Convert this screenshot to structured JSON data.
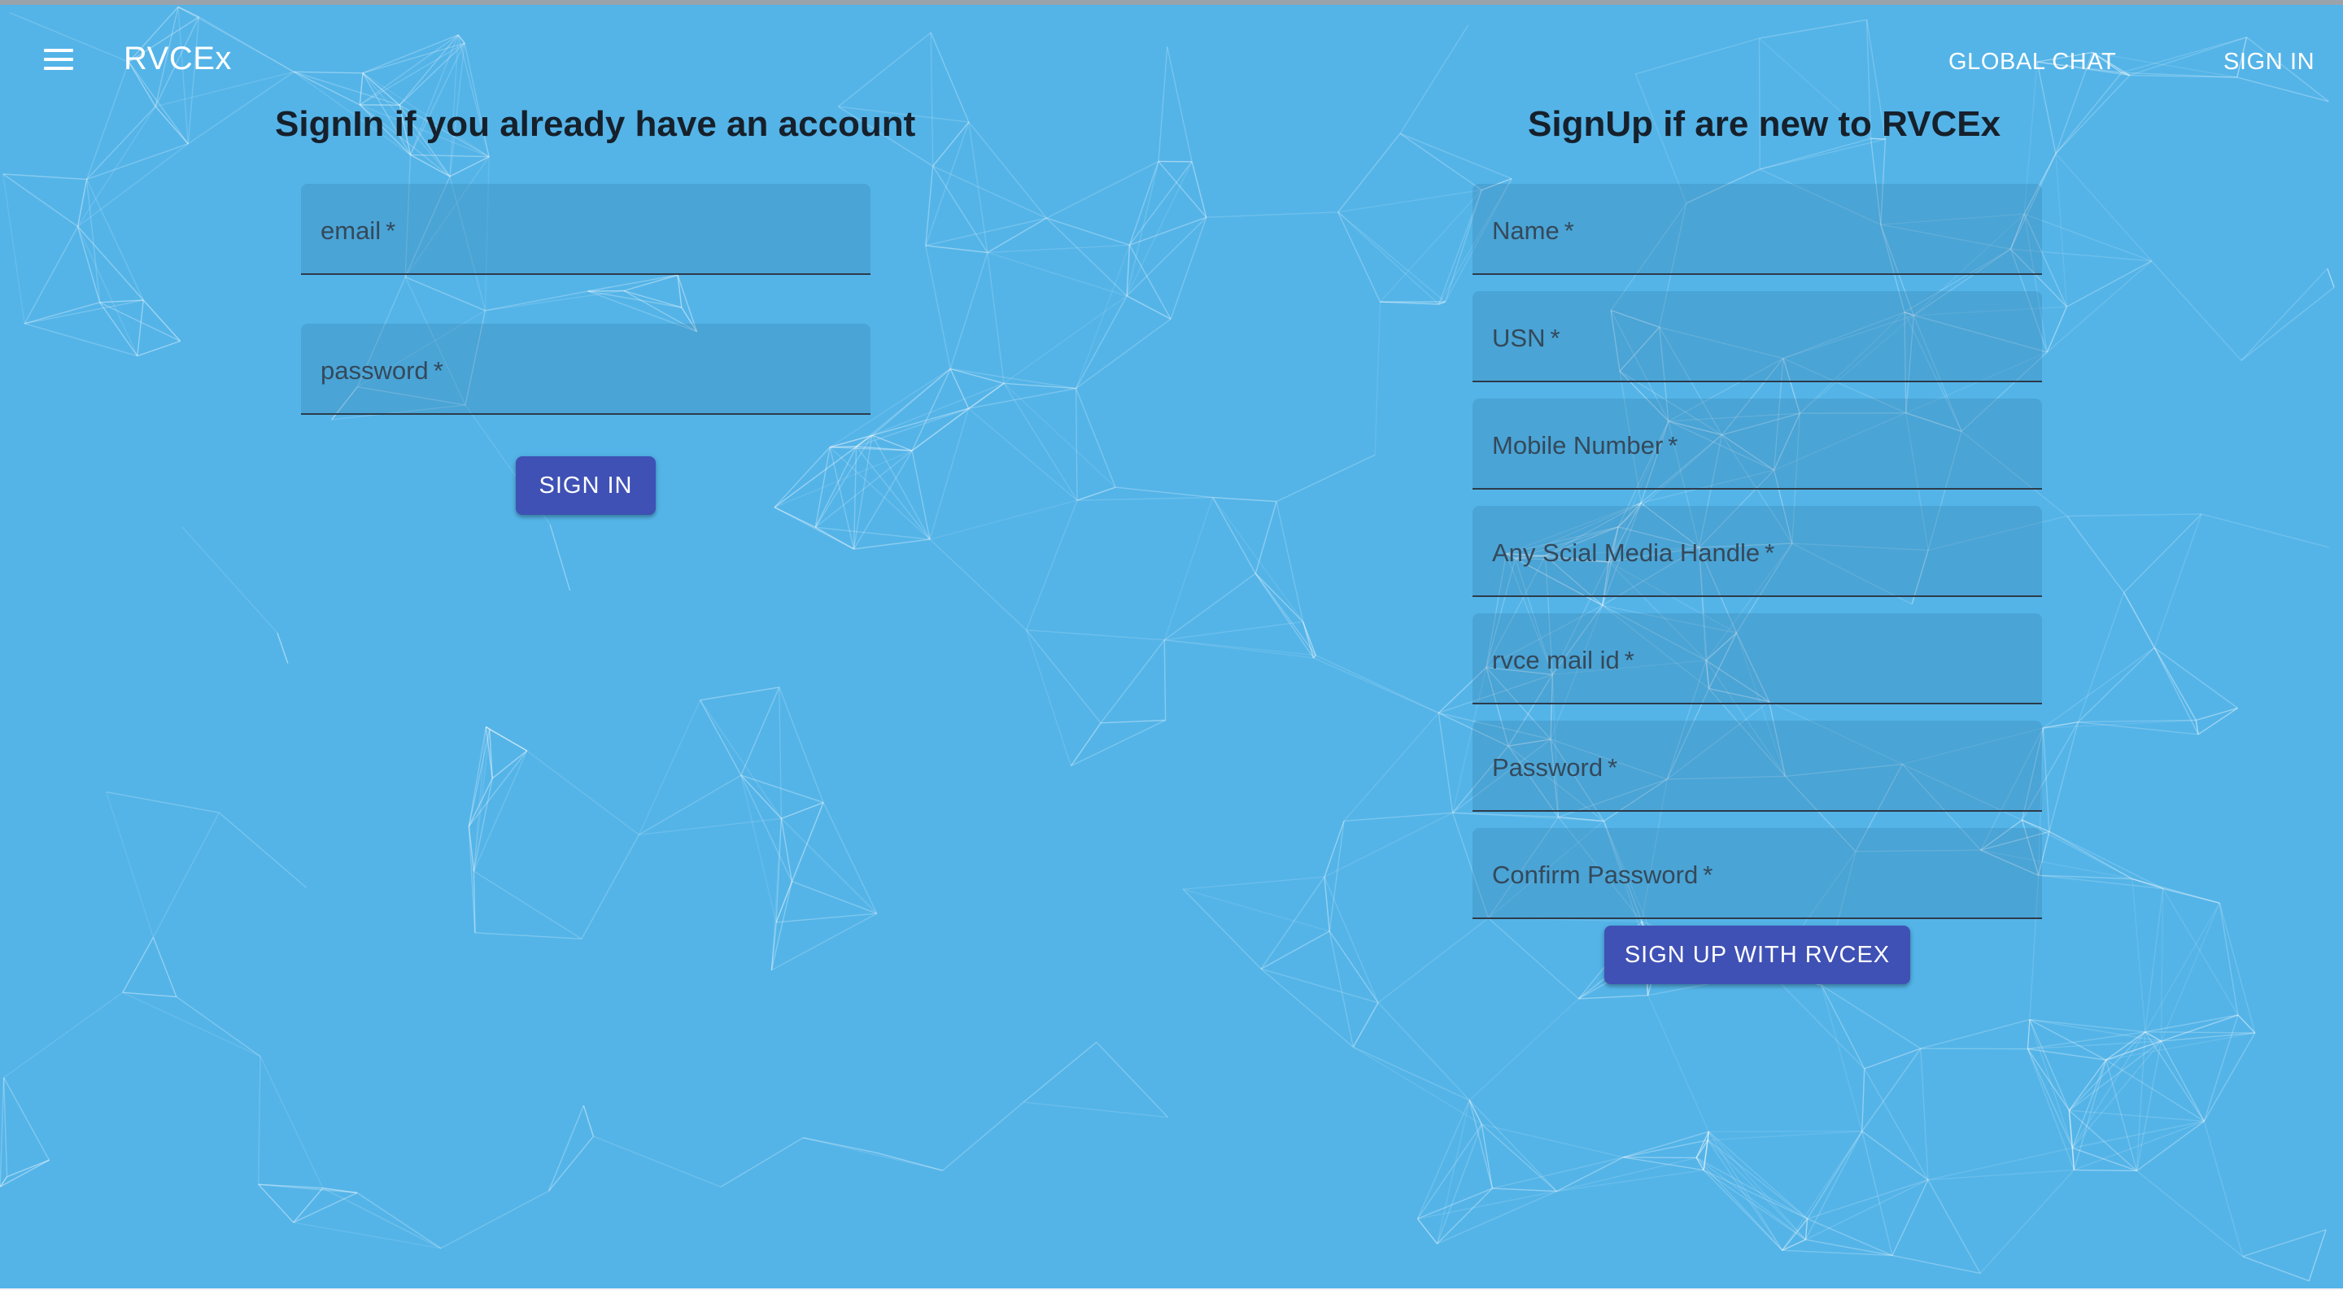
{
  "appbar": {
    "title": "RVCEx",
    "nav": {
      "global_chat": "GLOBAL CHAT",
      "sign_in": "SIGN IN"
    }
  },
  "signin": {
    "heading": "SignIn if you already have an account",
    "fields": [
      {
        "label": "email",
        "required": "*"
      },
      {
        "label": "password",
        "required": "*"
      }
    ],
    "button": "SIGN IN"
  },
  "signup": {
    "heading": "SignUp if are new to RVCEx",
    "fields": [
      {
        "label": "Name",
        "required": "*"
      },
      {
        "label": "USN",
        "required": "*"
      },
      {
        "label": "Mobile Number",
        "required": "*"
      },
      {
        "label": "Any Scial Media Handle",
        "required": "*"
      },
      {
        "label": "rvce mail id",
        "required": "*"
      },
      {
        "label": "Password",
        "required": "*"
      },
      {
        "label": "Confirm Password",
        "required": "*"
      }
    ],
    "button": "SIGN UP WITH RVCEX"
  },
  "colors": {
    "background": "#54b4e8",
    "button": "#3f51b5",
    "heading_text": "#16202b"
  },
  "icons": {
    "menu": "hamburger-menu-icon"
  }
}
